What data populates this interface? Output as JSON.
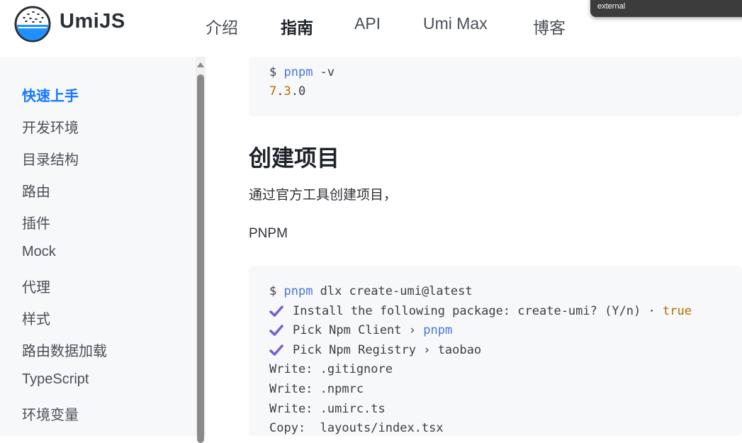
{
  "header": {
    "brand": "UmiJS",
    "nav": [
      "介绍",
      "指南",
      "API",
      "Umi Max",
      "博客"
    ],
    "active_nav": "指南"
  },
  "toast": {
    "text": "external"
  },
  "sidebar": {
    "items": [
      "快速上手",
      "开发环境",
      "目录结构",
      "路由",
      "插件",
      "Mock",
      "代理",
      "样式",
      "路由数据加载",
      "TypeScript",
      "环境变量"
    ],
    "active": "快速上手"
  },
  "content": {
    "code1": {
      "line1": {
        "prompt": "$ ",
        "cmd": "pnpm",
        "rest": " -v"
      },
      "line2": {
        "major": "7",
        "dot1": ".",
        "minor": "3",
        "rest": ".0"
      }
    },
    "heading": "创建项目",
    "intro": "通过官方工具创建项目，",
    "pnpm_label": "PNPM",
    "code2": {
      "line1": {
        "prompt": "$ ",
        "cmd": "pnpm",
        "rest": " dlx create-umi@latest"
      },
      "line2": {
        "text": "Install the following package: create-umi? (Y/n) · ",
        "value": "true"
      },
      "line3": {
        "text": "Pick Npm Client › ",
        "value": "pnpm"
      },
      "line4": {
        "text": "Pick Npm Registry › taobao"
      },
      "line5": "Write: .gitignore",
      "line6": "Write: .npmrc",
      "line7": "Write: .umirc.ts",
      "line8": "Copy:  layouts/index.tsx"
    }
  },
  "colors": {
    "accent": "#1677ff",
    "check": "#7b5fd3",
    "code_blue": "#4876d6",
    "code_orange": "#b76b01"
  }
}
